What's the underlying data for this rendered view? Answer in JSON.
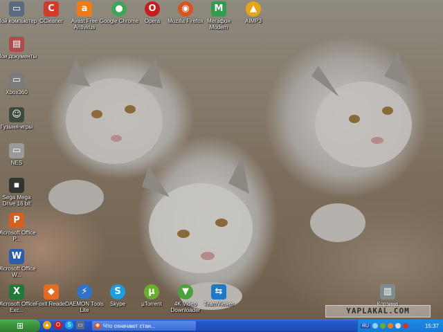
{
  "desktop": {
    "icons": [
      {
        "id": "my-computer",
        "label": "Мой компьютер",
        "glyph": "▭",
        "color": "#5a6a80"
      },
      {
        "id": "ccleaner",
        "label": "CCleaner",
        "glyph": "C",
        "color": "#d43a2a"
      },
      {
        "id": "avast",
        "label": "Avast Free Antivirus",
        "glyph": "a",
        "color": "#f07b14"
      },
      {
        "id": "chrome",
        "label": "Google Chrome",
        "glyph": "●",
        "color": "#3aa757"
      },
      {
        "id": "opera",
        "label": "Opera",
        "glyph": "O",
        "color": "#cc1b1b"
      },
      {
        "id": "firefox",
        "label": "Mozilla Firefox",
        "glyph": "◉",
        "color": "#d9521f"
      },
      {
        "id": "megafon",
        "label": "Мегафон Modem",
        "glyph": "M",
        "color": "#2f9d4b"
      },
      {
        "id": "aimp",
        "label": "AIMP3",
        "glyph": "▲",
        "color": "#e7a516"
      },
      {
        "id": "my-documents",
        "label": "Мои документы",
        "glyph": "▤",
        "color": "#b24a4a"
      },
      {
        "id": "xbox360",
        "label": "Xbox360",
        "glyph": "▭",
        "color": "#7b7b7b"
      },
      {
        "id": "games",
        "label": "Гузыня-игры",
        "glyph": "☺",
        "color": "#3d4b3a"
      },
      {
        "id": "nes",
        "label": "NES",
        "glyph": "▭",
        "color": "#9a9a9a"
      },
      {
        "id": "sega",
        "label": "Sega Mega Drive 16 bit",
        "glyph": "▪",
        "color": "#333333"
      },
      {
        "id": "office-p",
        "label": "Microsoft Office P...",
        "glyph": "P",
        "color": "#d2611f"
      },
      {
        "id": "word",
        "label": "Microsoft Office W...",
        "glyph": "W",
        "color": "#2a5db0"
      },
      {
        "id": "excel",
        "label": "Microsoft Office Exc...",
        "glyph": "X",
        "color": "#1f7a3a"
      },
      {
        "id": "foxit",
        "label": "Foxit Reader",
        "glyph": "◆",
        "color": "#e86a1e"
      },
      {
        "id": "daemon",
        "label": "DAEMON Tools Lite",
        "glyph": "⚡",
        "color": "#2f73c8"
      },
      {
        "id": "skype",
        "label": "Skype",
        "glyph": "S",
        "color": "#1aa0e0"
      },
      {
        "id": "utorrent",
        "label": "µTorrent",
        "glyph": "µ",
        "color": "#6aad2f"
      },
      {
        "id": "4kvideo",
        "label": "4K Video Downloader",
        "glyph": "▼",
        "color": "#4aa33a"
      },
      {
        "id": "teamviewer",
        "label": "TeamViewer",
        "glyph": "⇆",
        "color": "#1f78c8"
      },
      {
        "id": "recycle",
        "label": "Корзина",
        "glyph": "▥",
        "color": "#7f8c8d"
      }
    ],
    "watermark": "YAPLAKAL.COM"
  },
  "taskbar": {
    "start_glyph": "⊞",
    "quick_launch": [
      {
        "id": "ql-aimp",
        "glyph": "▲",
        "color": "#e7a516"
      },
      {
        "id": "ql-opera",
        "glyph": "O",
        "color": "#cc1b1b"
      },
      {
        "id": "ql-skype",
        "glyph": "S",
        "color": "#1aa0e0"
      },
      {
        "id": "ql-desktop",
        "glyph": "▭",
        "color": "#5a6a80"
      }
    ],
    "active_task": {
      "label": "Что означают стан...",
      "glyph": "◉",
      "color": "#d9521f"
    },
    "tray": {
      "language": "RU",
      "clock": "15:37"
    }
  }
}
